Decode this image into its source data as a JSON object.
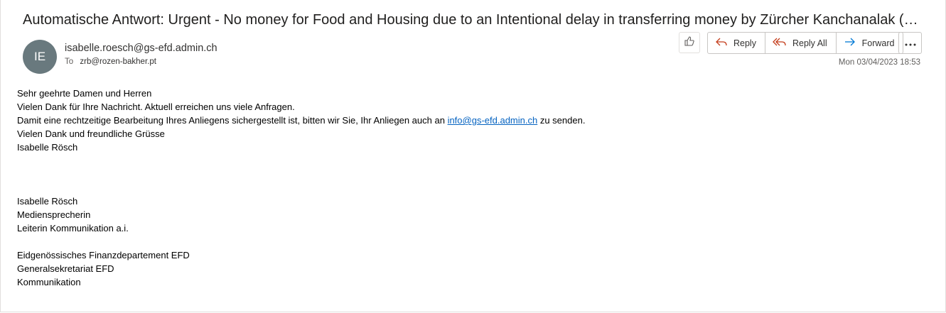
{
  "subject": "Automatische Antwort: Urgent - No money for Food and Housing due to an Intentional delay in transferring money by Zürcher Kanchanalak (ZKB) a...",
  "sender": {
    "initials": "IE",
    "email": "isabelle.roesch@gs-efd.admin.ch",
    "to_label": "To",
    "to_address": "zrb@rozen-bakher.pt"
  },
  "actions": {
    "reply": "Reply",
    "reply_all": "Reply All",
    "forward": "Forward"
  },
  "date": "Mon 03/04/2023 18:53",
  "body": {
    "greeting": "Sehr geehrte Damen und Herren",
    "line1": "Vielen Dank für Ihre Nachricht. Aktuell erreichen uns viele Anfragen.",
    "line2_before": "Damit eine rechtzeitige Bearbeitung Ihres Anliegens sichergestellt ist, bitten wir Sie, Ihr Anliegen auch an ",
    "line2_link": "info@gs-efd.admin.ch",
    "line2_after": " zu senden.",
    "line3": "Vielen Dank und freundliche Grüsse",
    "line4": "Isabelle Rösch",
    "sig_name": "Isabelle Rösch",
    "sig_role1": "Mediensprecherin",
    "sig_role2": "Leiterin Kommunikation a.i.",
    "sig_org1": "Eidgenössisches Finanzdepartement EFD",
    "sig_org2": "Generalsekretariat EFD",
    "sig_org3": "Kommunikation"
  },
  "colors": {
    "avatar_bg": "#69797e",
    "accent": "#0078d4",
    "reply_icon": "#c43e1c",
    "link": "#0563c1"
  },
  "icons": [
    "like-icon",
    "reply-icon",
    "reply-all-icon",
    "forward-icon",
    "more-icon"
  ]
}
